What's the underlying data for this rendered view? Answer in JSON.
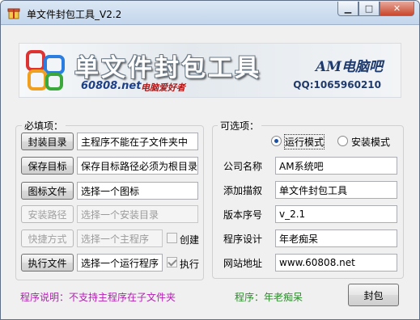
{
  "window": {
    "title": "单文件封包工具_V2.2",
    "minimize_glyph": "▁",
    "maximize_glyph": "□",
    "close_glyph": "✕"
  },
  "banner": {
    "title": "单文件封包工具",
    "site": "60808.net",
    "slogan": "电脑爱好者",
    "brand": "AM电脑吧",
    "qq": "QQ:1065960210"
  },
  "required": {
    "group_label": "必填项：",
    "rows": [
      {
        "button": "封装目录",
        "value": "主程序不能在子文件夹中"
      },
      {
        "button": "保存目标",
        "value": "保存目标路径必须为根目录"
      },
      {
        "button": "图标文件",
        "value": "选择一个图标"
      },
      {
        "button": "安装路径",
        "value": "选择一个安装目录"
      },
      {
        "button": "快捷方式",
        "value": "选择一个主程序"
      },
      {
        "button": "执行文件",
        "value": "选择一个运行程序"
      }
    ],
    "shortcut_checkbox_label": "创建",
    "exec_checkbox_label": "执行"
  },
  "optional": {
    "group_label": "可选项：",
    "mode_run": "运行模式",
    "mode_install": "安装模式",
    "rows": [
      {
        "label": "公司名称",
        "value": "AM系统吧"
      },
      {
        "label": "添加描叙",
        "value": "单文件封包工具"
      },
      {
        "label": "版本序号",
        "value": "v_2.1"
      },
      {
        "label": "程序设计",
        "value": "年老痴呆"
      },
      {
        "label": "网站地址",
        "value": "www.60808.net"
      }
    ]
  },
  "footer": {
    "note": "程序说明：不支持主程序在子文件夹",
    "author": "程序：年老痴呆",
    "pack_button": "封包"
  },
  "colors": {
    "note": "#b21fb2",
    "author": "#2c8a2c",
    "radio_dot": "#1a4fa6"
  }
}
